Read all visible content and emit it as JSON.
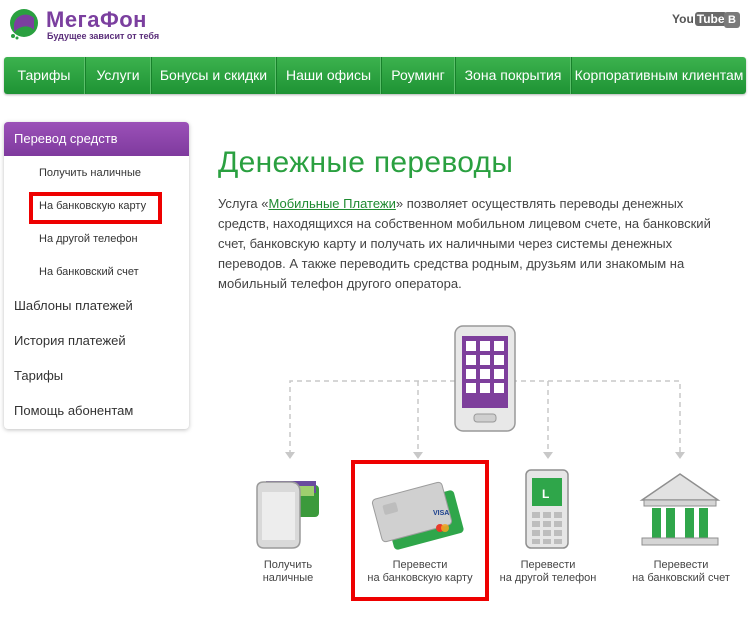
{
  "header": {
    "brand": "МегаФон",
    "tagline": "Будущее зависит от тебя",
    "youtube_you": "You",
    "youtube_tube": "Tube",
    "vk": "B"
  },
  "nav": [
    "Тарифы",
    "Услуги",
    "Бонусы и скидки",
    "Наши офисы",
    "Роуминг",
    "Зона покрытия",
    "Корпоративным клиентам"
  ],
  "sidebar": {
    "section": "Перевод средств",
    "sub_items": [
      "Получить наличные",
      "На банковскую карту",
      "На другой телефон",
      "На банковский счет"
    ],
    "items": [
      "Шаблоны платежей",
      "История платежей",
      "Тарифы",
      "Помощь абонентам"
    ]
  },
  "main": {
    "title": "Денежные переводы",
    "desc_before": "Услуга «",
    "desc_link": "Мобильные Платежи",
    "desc_after": "» позволяет осуществлять переводы денежных средств, находящихся на собственном мобильном лицевом счете, на банковский счет, банковскую карту и получать их наличными через системы денежных переводов. А также переводить средства родным, друзьям или знакомым на мобильный телефон другого оператора."
  },
  "options": [
    {
      "line1": "Получить",
      "line2": "наличные"
    },
    {
      "line1": "Перевести",
      "line2": "на банковскую карту"
    },
    {
      "line1": "Перевести",
      "line2": "на другой телефон"
    },
    {
      "line1": "Перевести",
      "line2": "на банковский счет"
    }
  ],
  "card_brand": "VISA",
  "colors": {
    "green": "#2aa040",
    "purple": "#7f3a9e",
    "highlight": "#e00000"
  }
}
